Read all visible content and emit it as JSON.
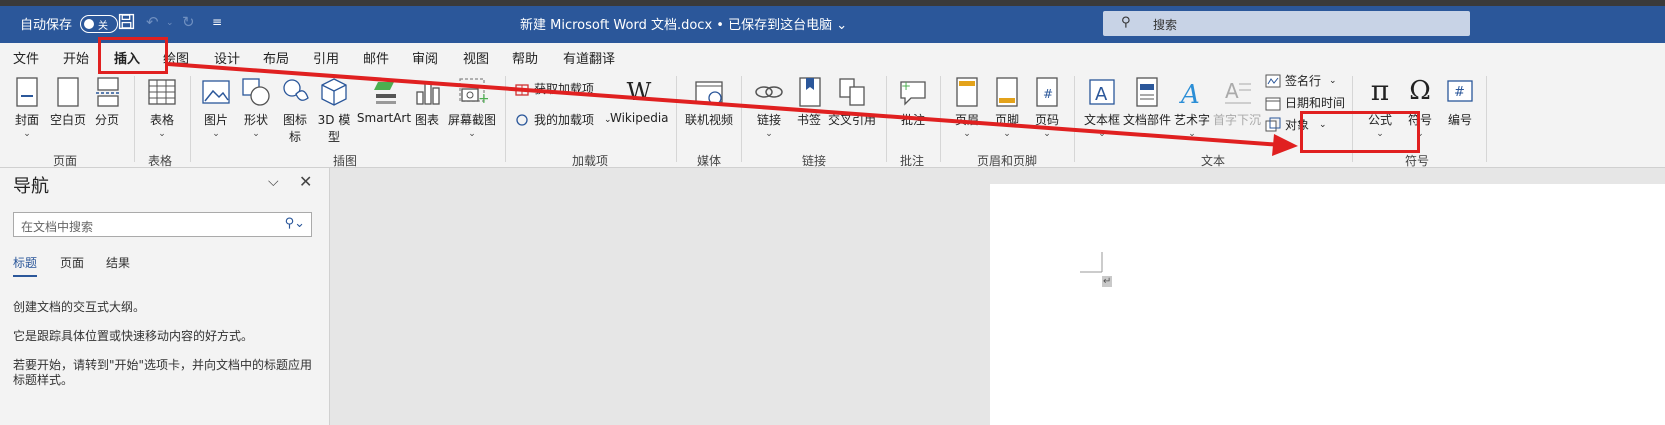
{
  "titlebar": {
    "autosave_label": "自动保存",
    "autosave_state": "关",
    "doc_title": "新建 Microsoft Word 文档.docx • 已保存到这台电脑 ⌄",
    "search_placeholder": "搜索",
    "bg_color": "#2b579a"
  },
  "tabs": [
    "文件",
    "开始",
    "插入",
    "绘图",
    "设计",
    "布局",
    "引用",
    "邮件",
    "审阅",
    "视图",
    "帮助",
    "有道翻译"
  ],
  "active_tab": "插入",
  "ribbon": {
    "pages": {
      "cover": "封面",
      "blank": "空白页",
      "break": "分页",
      "label": "页面"
    },
    "tables": {
      "table": "表格",
      "label": "表格"
    },
    "illustrations": {
      "pictures": "图片",
      "shapes": "形状",
      "icons": "图标",
      "model3d_1": "3D 模",
      "model3d_2": "型",
      "smartart": "SmartArt",
      "chart": "图表",
      "screenshot": "屏幕截图",
      "label": "插图"
    },
    "addins": {
      "get": "获取加载项",
      "my": "我的加载项",
      "wikipedia": "Wikipedia",
      "label": "加载项"
    },
    "media": {
      "video": "联机视频",
      "label": "媒体"
    },
    "links": {
      "link": "链接",
      "bookmark": "书签",
      "crossref": "交叉引用",
      "label": "链接"
    },
    "comments": {
      "comment": "批注",
      "label": "批注"
    },
    "header_footer": {
      "header": "页眉",
      "footer": "页脚",
      "pagenum": "页码",
      "label": "页眉和页脚"
    },
    "text": {
      "textbox": "文本框",
      "quickparts": "文档部件",
      "wordart": "艺术字",
      "dropcap": "首字下沉",
      "signature": "签名行",
      "datetime": "日期和时间",
      "object": "对象",
      "label": "文本"
    },
    "symbols": {
      "equation": "公式",
      "symbol": "符号",
      "number": "编号",
      "label": "符号"
    }
  },
  "nav": {
    "title": "导航",
    "search_placeholder": "在文档中搜索",
    "tabs": [
      "标题",
      "页面",
      "结果"
    ],
    "text1": "创建文档的交互式大纲。",
    "text2": "它是跟踪具体位置或快速移动内容的好方式。",
    "text3": "若要开始，请转到\"开始\"选项卡，并向文档中的标题应用标题样式。"
  },
  "paragraph_mark": "↵",
  "annotation_color": "#e02020"
}
